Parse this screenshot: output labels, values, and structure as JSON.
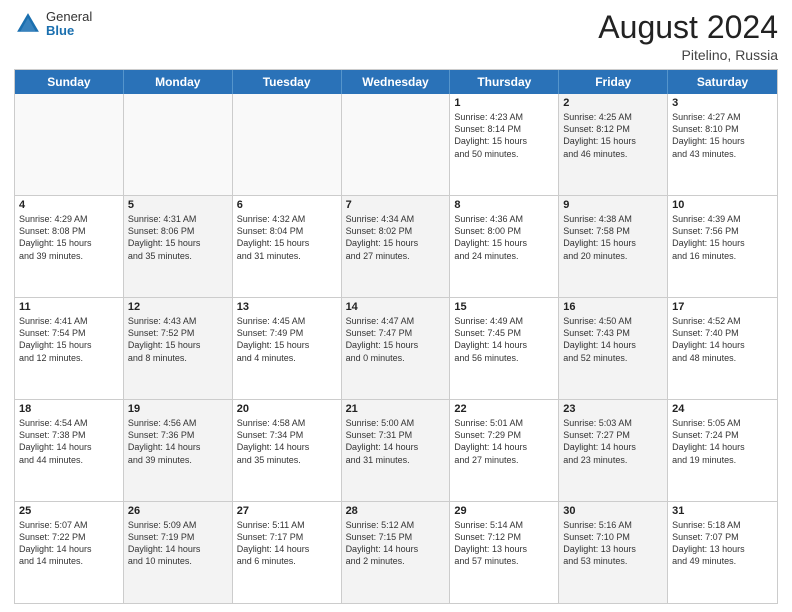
{
  "header": {
    "logo_general": "General",
    "logo_blue": "Blue",
    "month_title": "August 2024",
    "location": "Pitelino, Russia"
  },
  "weekdays": [
    "Sunday",
    "Monday",
    "Tuesday",
    "Wednesday",
    "Thursday",
    "Friday",
    "Saturday"
  ],
  "rows": [
    [
      {
        "day": "",
        "text": "",
        "empty": true
      },
      {
        "day": "",
        "text": "",
        "empty": true
      },
      {
        "day": "",
        "text": "",
        "empty": true
      },
      {
        "day": "",
        "text": "",
        "empty": true
      },
      {
        "day": "1",
        "text": "Sunrise: 4:23 AM\nSunset: 8:14 PM\nDaylight: 15 hours\nand 50 minutes.",
        "empty": false
      },
      {
        "day": "2",
        "text": "Sunrise: 4:25 AM\nSunset: 8:12 PM\nDaylight: 15 hours\nand 46 minutes.",
        "empty": false
      },
      {
        "day": "3",
        "text": "Sunrise: 4:27 AM\nSunset: 8:10 PM\nDaylight: 15 hours\nand 43 minutes.",
        "empty": false
      }
    ],
    [
      {
        "day": "4",
        "text": "Sunrise: 4:29 AM\nSunset: 8:08 PM\nDaylight: 15 hours\nand 39 minutes.",
        "empty": false
      },
      {
        "day": "5",
        "text": "Sunrise: 4:31 AM\nSunset: 8:06 PM\nDaylight: 15 hours\nand 35 minutes.",
        "empty": false
      },
      {
        "day": "6",
        "text": "Sunrise: 4:32 AM\nSunset: 8:04 PM\nDaylight: 15 hours\nand 31 minutes.",
        "empty": false
      },
      {
        "day": "7",
        "text": "Sunrise: 4:34 AM\nSunset: 8:02 PM\nDaylight: 15 hours\nand 27 minutes.",
        "empty": false
      },
      {
        "day": "8",
        "text": "Sunrise: 4:36 AM\nSunset: 8:00 PM\nDaylight: 15 hours\nand 24 minutes.",
        "empty": false
      },
      {
        "day": "9",
        "text": "Sunrise: 4:38 AM\nSunset: 7:58 PM\nDaylight: 15 hours\nand 20 minutes.",
        "empty": false
      },
      {
        "day": "10",
        "text": "Sunrise: 4:39 AM\nSunset: 7:56 PM\nDaylight: 15 hours\nand 16 minutes.",
        "empty": false
      }
    ],
    [
      {
        "day": "11",
        "text": "Sunrise: 4:41 AM\nSunset: 7:54 PM\nDaylight: 15 hours\nand 12 minutes.",
        "empty": false
      },
      {
        "day": "12",
        "text": "Sunrise: 4:43 AM\nSunset: 7:52 PM\nDaylight: 15 hours\nand 8 minutes.",
        "empty": false
      },
      {
        "day": "13",
        "text": "Sunrise: 4:45 AM\nSunset: 7:49 PM\nDaylight: 15 hours\nand 4 minutes.",
        "empty": false
      },
      {
        "day": "14",
        "text": "Sunrise: 4:47 AM\nSunset: 7:47 PM\nDaylight: 15 hours\nand 0 minutes.",
        "empty": false
      },
      {
        "day": "15",
        "text": "Sunrise: 4:49 AM\nSunset: 7:45 PM\nDaylight: 14 hours\nand 56 minutes.",
        "empty": false
      },
      {
        "day": "16",
        "text": "Sunrise: 4:50 AM\nSunset: 7:43 PM\nDaylight: 14 hours\nand 52 minutes.",
        "empty": false
      },
      {
        "day": "17",
        "text": "Sunrise: 4:52 AM\nSunset: 7:40 PM\nDaylight: 14 hours\nand 48 minutes.",
        "empty": false
      }
    ],
    [
      {
        "day": "18",
        "text": "Sunrise: 4:54 AM\nSunset: 7:38 PM\nDaylight: 14 hours\nand 44 minutes.",
        "empty": false
      },
      {
        "day": "19",
        "text": "Sunrise: 4:56 AM\nSunset: 7:36 PM\nDaylight: 14 hours\nand 39 minutes.",
        "empty": false
      },
      {
        "day": "20",
        "text": "Sunrise: 4:58 AM\nSunset: 7:34 PM\nDaylight: 14 hours\nand 35 minutes.",
        "empty": false
      },
      {
        "day": "21",
        "text": "Sunrise: 5:00 AM\nSunset: 7:31 PM\nDaylight: 14 hours\nand 31 minutes.",
        "empty": false
      },
      {
        "day": "22",
        "text": "Sunrise: 5:01 AM\nSunset: 7:29 PM\nDaylight: 14 hours\nand 27 minutes.",
        "empty": false
      },
      {
        "day": "23",
        "text": "Sunrise: 5:03 AM\nSunset: 7:27 PM\nDaylight: 14 hours\nand 23 minutes.",
        "empty": false
      },
      {
        "day": "24",
        "text": "Sunrise: 5:05 AM\nSunset: 7:24 PM\nDaylight: 14 hours\nand 19 minutes.",
        "empty": false
      }
    ],
    [
      {
        "day": "25",
        "text": "Sunrise: 5:07 AM\nSunset: 7:22 PM\nDaylight: 14 hours\nand 14 minutes.",
        "empty": false
      },
      {
        "day": "26",
        "text": "Sunrise: 5:09 AM\nSunset: 7:19 PM\nDaylight: 14 hours\nand 10 minutes.",
        "empty": false
      },
      {
        "day": "27",
        "text": "Sunrise: 5:11 AM\nSunset: 7:17 PM\nDaylight: 14 hours\nand 6 minutes.",
        "empty": false
      },
      {
        "day": "28",
        "text": "Sunrise: 5:12 AM\nSunset: 7:15 PM\nDaylight: 14 hours\nand 2 minutes.",
        "empty": false
      },
      {
        "day": "29",
        "text": "Sunrise: 5:14 AM\nSunset: 7:12 PM\nDaylight: 13 hours\nand 57 minutes.",
        "empty": false
      },
      {
        "day": "30",
        "text": "Sunrise: 5:16 AM\nSunset: 7:10 PM\nDaylight: 13 hours\nand 53 minutes.",
        "empty": false
      },
      {
        "day": "31",
        "text": "Sunrise: 5:18 AM\nSunset: 7:07 PM\nDaylight: 13 hours\nand 49 minutes.",
        "empty": false
      }
    ]
  ]
}
